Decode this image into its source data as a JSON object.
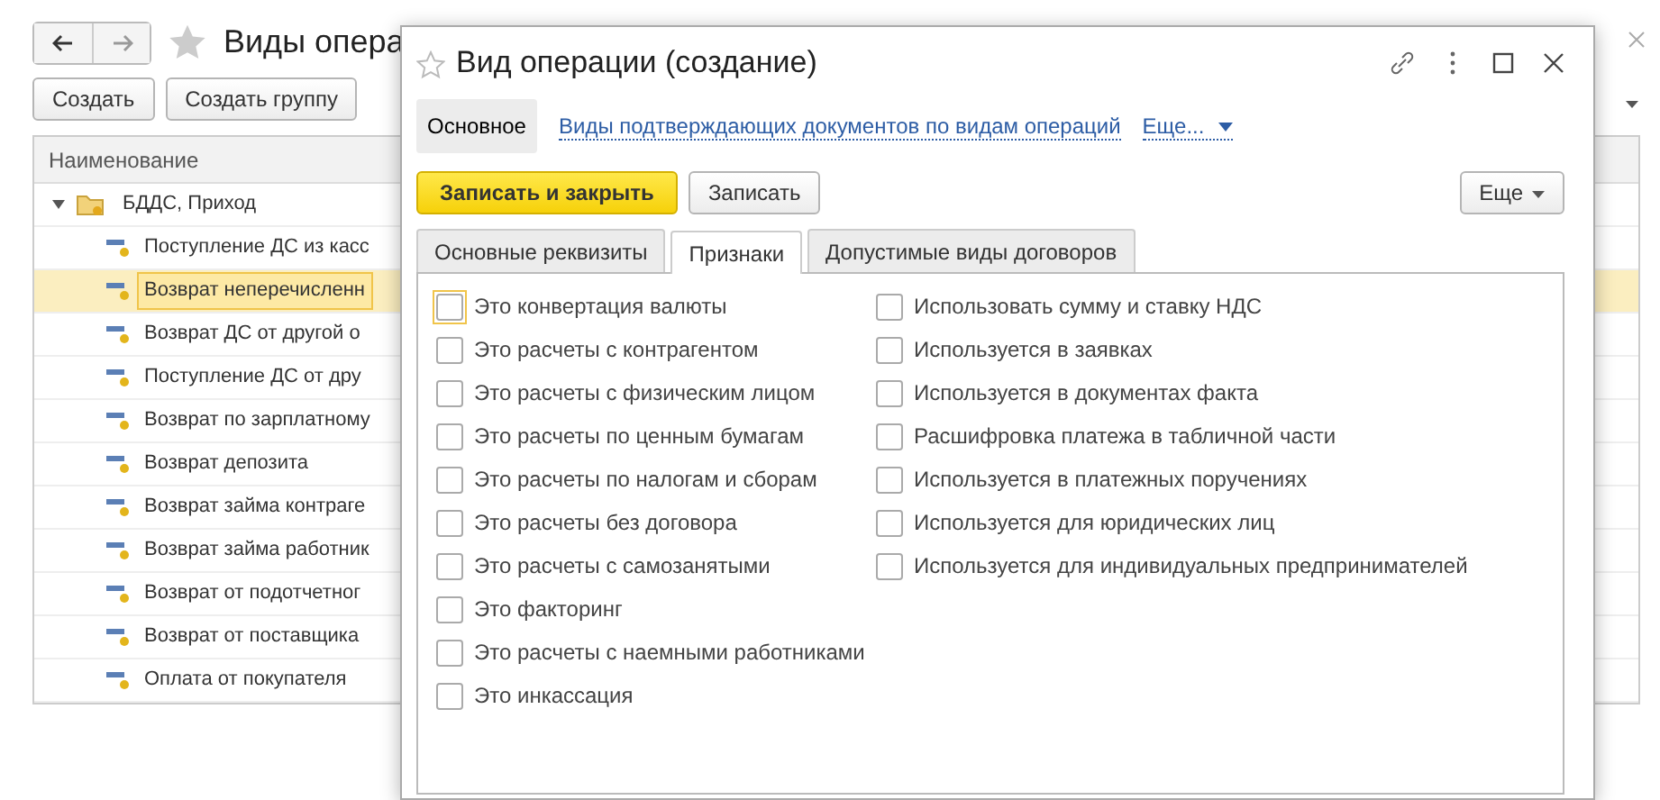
{
  "main_window": {
    "title": "Виды опера",
    "buttons": [
      "Создать",
      "Создать группу"
    ],
    "list": {
      "column": "Наименование",
      "group": {
        "label": "БДДС, Приход",
        "expanded": true,
        "children": [
          {
            "label": "Поступление ДС из касс",
            "selected": false
          },
          {
            "label": "Возврат неперечисленн",
            "selected": true
          },
          {
            "label": "Возврат ДС от другой о",
            "selected": false
          },
          {
            "label": "Поступление ДС от дру",
            "selected": false
          },
          {
            "label": "Возврат по зарплатному",
            "selected": false
          },
          {
            "label": "Возврат депозита",
            "selected": false
          },
          {
            "label": "Возврат займа контраге",
            "selected": false
          },
          {
            "label": "Возврат займа работник",
            "selected": false
          },
          {
            "label": "Возврат от подотчетног",
            "selected": false
          },
          {
            "label": "Возврат от поставщика",
            "selected": false
          },
          {
            "label": "Оплата от покупателя",
            "selected": false
          }
        ]
      }
    }
  },
  "dialog": {
    "title": "Вид операции (создание)",
    "nav": [
      {
        "label": "Основное",
        "kind": "tab",
        "selected": true
      },
      {
        "label": "Виды подтверждающих документов по видам операций",
        "kind": "link",
        "selected": false
      },
      {
        "label": "Еще...",
        "kind": "menu",
        "selected": false
      }
    ],
    "toolbar": {
      "primary": "Записать и закрыть",
      "secondary": "Записать",
      "more": "Еще"
    },
    "tabs": [
      {
        "label": "Основные реквизиты",
        "selected": false
      },
      {
        "label": "Признаки",
        "selected": true
      },
      {
        "label": "Допустимые виды договоров",
        "selected": false
      }
    ],
    "flags_left": [
      {
        "label": "Это конвертация валюты",
        "checked": false,
        "focused": true
      },
      {
        "label": "Это расчеты с контрагентом",
        "checked": false,
        "focused": false
      },
      {
        "label": "Это расчеты с физическим лицом",
        "checked": false,
        "focused": false
      },
      {
        "label": "Это расчеты по ценным бумагам",
        "checked": false,
        "focused": false
      },
      {
        "label": "Это расчеты по налогам и сборам",
        "checked": false,
        "focused": false
      },
      {
        "label": "Это расчеты без договора",
        "checked": false,
        "focused": false
      },
      {
        "label": "Это расчеты с самозанятыми",
        "checked": false,
        "focused": false
      },
      {
        "label": "Это факторинг",
        "checked": false,
        "focused": false
      },
      {
        "label": "Это расчеты с наемными работниками",
        "checked": false,
        "focused": false
      },
      {
        "label": "Это инкассация",
        "checked": false,
        "focused": false
      }
    ],
    "flags_right": [
      {
        "label": "Использовать сумму и ставку НДС",
        "checked": false,
        "focused": false
      },
      {
        "label": "Используется в заявках",
        "checked": false,
        "focused": false
      },
      {
        "label": "Используется в документах факта",
        "checked": false,
        "focused": false
      },
      {
        "label": "Расшифровка платежа в табличной части",
        "checked": false,
        "focused": false
      },
      {
        "label": "Используется в платежных поручениях",
        "checked": false,
        "focused": false
      },
      {
        "label": "Используется для юридических лиц",
        "checked": false,
        "focused": false
      },
      {
        "label": "Используется для индивидуальных предпринимателей",
        "checked": false,
        "focused": false
      }
    ]
  }
}
